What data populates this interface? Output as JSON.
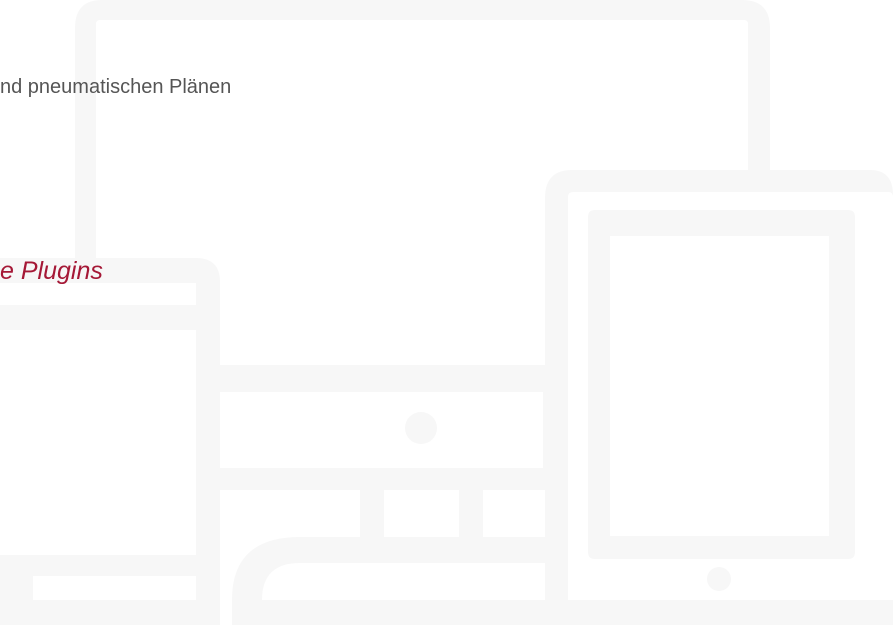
{
  "hero": {
    "subtitle": "nd pneumatischen Plänen",
    "tagline": "e Plugins"
  },
  "illustration": {
    "icon": "responsive-devices-icon",
    "color": "#f7f7f7",
    "accent_color": "#a51836"
  }
}
